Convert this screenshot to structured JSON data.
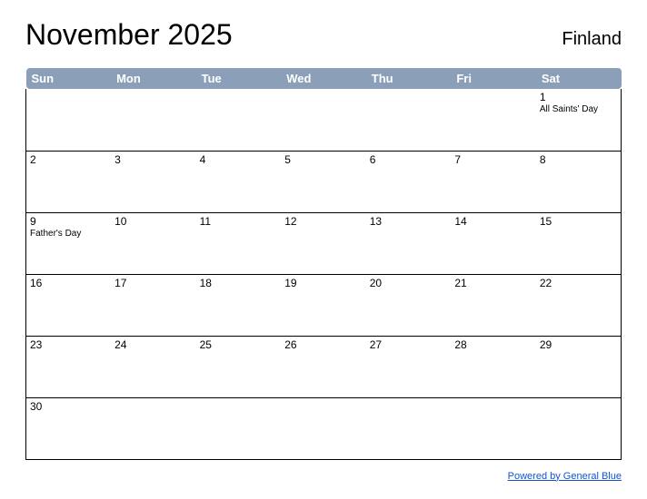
{
  "header": {
    "title": "November 2025",
    "region": "Finland"
  },
  "days": [
    "Sun",
    "Mon",
    "Tue",
    "Wed",
    "Thu",
    "Fri",
    "Sat"
  ],
  "weeks": [
    [
      {
        "num": "",
        "event": ""
      },
      {
        "num": "",
        "event": ""
      },
      {
        "num": "",
        "event": ""
      },
      {
        "num": "",
        "event": ""
      },
      {
        "num": "",
        "event": ""
      },
      {
        "num": "",
        "event": ""
      },
      {
        "num": "1",
        "event": "All Saints' Day"
      }
    ],
    [
      {
        "num": "2",
        "event": ""
      },
      {
        "num": "3",
        "event": ""
      },
      {
        "num": "4",
        "event": ""
      },
      {
        "num": "5",
        "event": ""
      },
      {
        "num": "6",
        "event": ""
      },
      {
        "num": "7",
        "event": ""
      },
      {
        "num": "8",
        "event": ""
      }
    ],
    [
      {
        "num": "9",
        "event": "Father's Day"
      },
      {
        "num": "10",
        "event": ""
      },
      {
        "num": "11",
        "event": ""
      },
      {
        "num": "12",
        "event": ""
      },
      {
        "num": "13",
        "event": ""
      },
      {
        "num": "14",
        "event": ""
      },
      {
        "num": "15",
        "event": ""
      }
    ],
    [
      {
        "num": "16",
        "event": ""
      },
      {
        "num": "17",
        "event": ""
      },
      {
        "num": "18",
        "event": ""
      },
      {
        "num": "19",
        "event": ""
      },
      {
        "num": "20",
        "event": ""
      },
      {
        "num": "21",
        "event": ""
      },
      {
        "num": "22",
        "event": ""
      }
    ],
    [
      {
        "num": "23",
        "event": ""
      },
      {
        "num": "24",
        "event": ""
      },
      {
        "num": "25",
        "event": ""
      },
      {
        "num": "26",
        "event": ""
      },
      {
        "num": "27",
        "event": ""
      },
      {
        "num": "28",
        "event": ""
      },
      {
        "num": "29",
        "event": ""
      }
    ],
    [
      {
        "num": "30",
        "event": ""
      },
      {
        "num": "",
        "event": ""
      },
      {
        "num": "",
        "event": ""
      },
      {
        "num": "",
        "event": ""
      },
      {
        "num": "",
        "event": ""
      },
      {
        "num": "",
        "event": ""
      },
      {
        "num": "",
        "event": ""
      }
    ]
  ],
  "footer": {
    "link_text": "Powered by General Blue"
  }
}
